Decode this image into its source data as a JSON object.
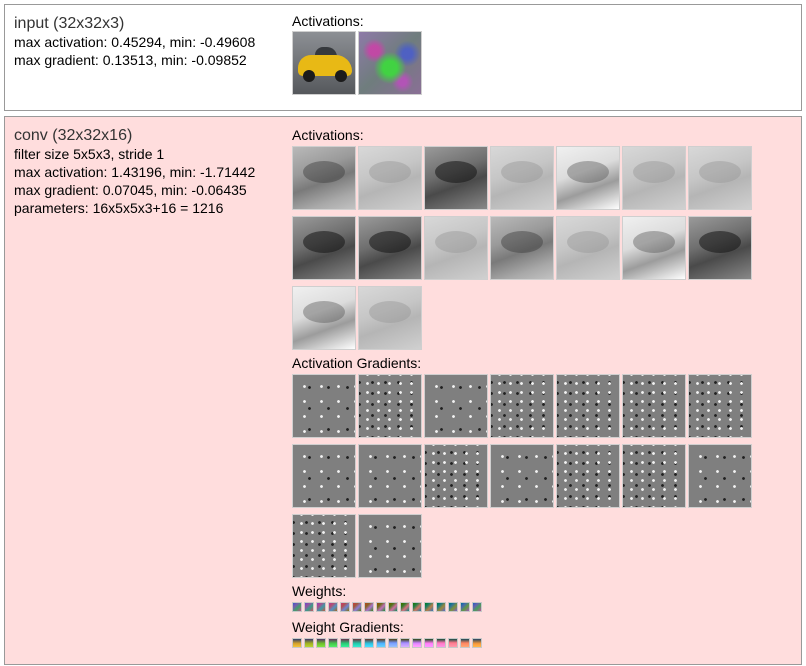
{
  "input_layer": {
    "title": "input (32x32x3)",
    "max_activation_line": "max activation: 0.45294, min: -0.49608",
    "max_gradient_line": "max gradient: 0.13513, min: -0.09852",
    "activations_label": "Activations:",
    "thumbnails": [
      "car-image",
      "input-gradient-image"
    ]
  },
  "conv_layer": {
    "title": "conv (32x32x16)",
    "filter_line": "filter size 5x5x3, stride 1",
    "max_activation_line": "max activation: 1.43196, min: -1.71442",
    "max_gradient_line": "max gradient: 0.07045, min: -0.06435",
    "parameters_line": "parameters: 16x5x5x3+16 = 1216",
    "activations_label": "Activations:",
    "activation_gradients_label": "Activation Gradients:",
    "weights_label": "Weights:",
    "weight_gradients_label": "Weight Gradients:",
    "activation_map_count": 16,
    "gradient_map_count": 16,
    "weight_count": 16,
    "weight_gradient_count": 16
  },
  "colors": {
    "input_bg": "#ffffff",
    "conv_bg": "#ffdddd",
    "border": "#999999",
    "title_color": "#333333"
  }
}
